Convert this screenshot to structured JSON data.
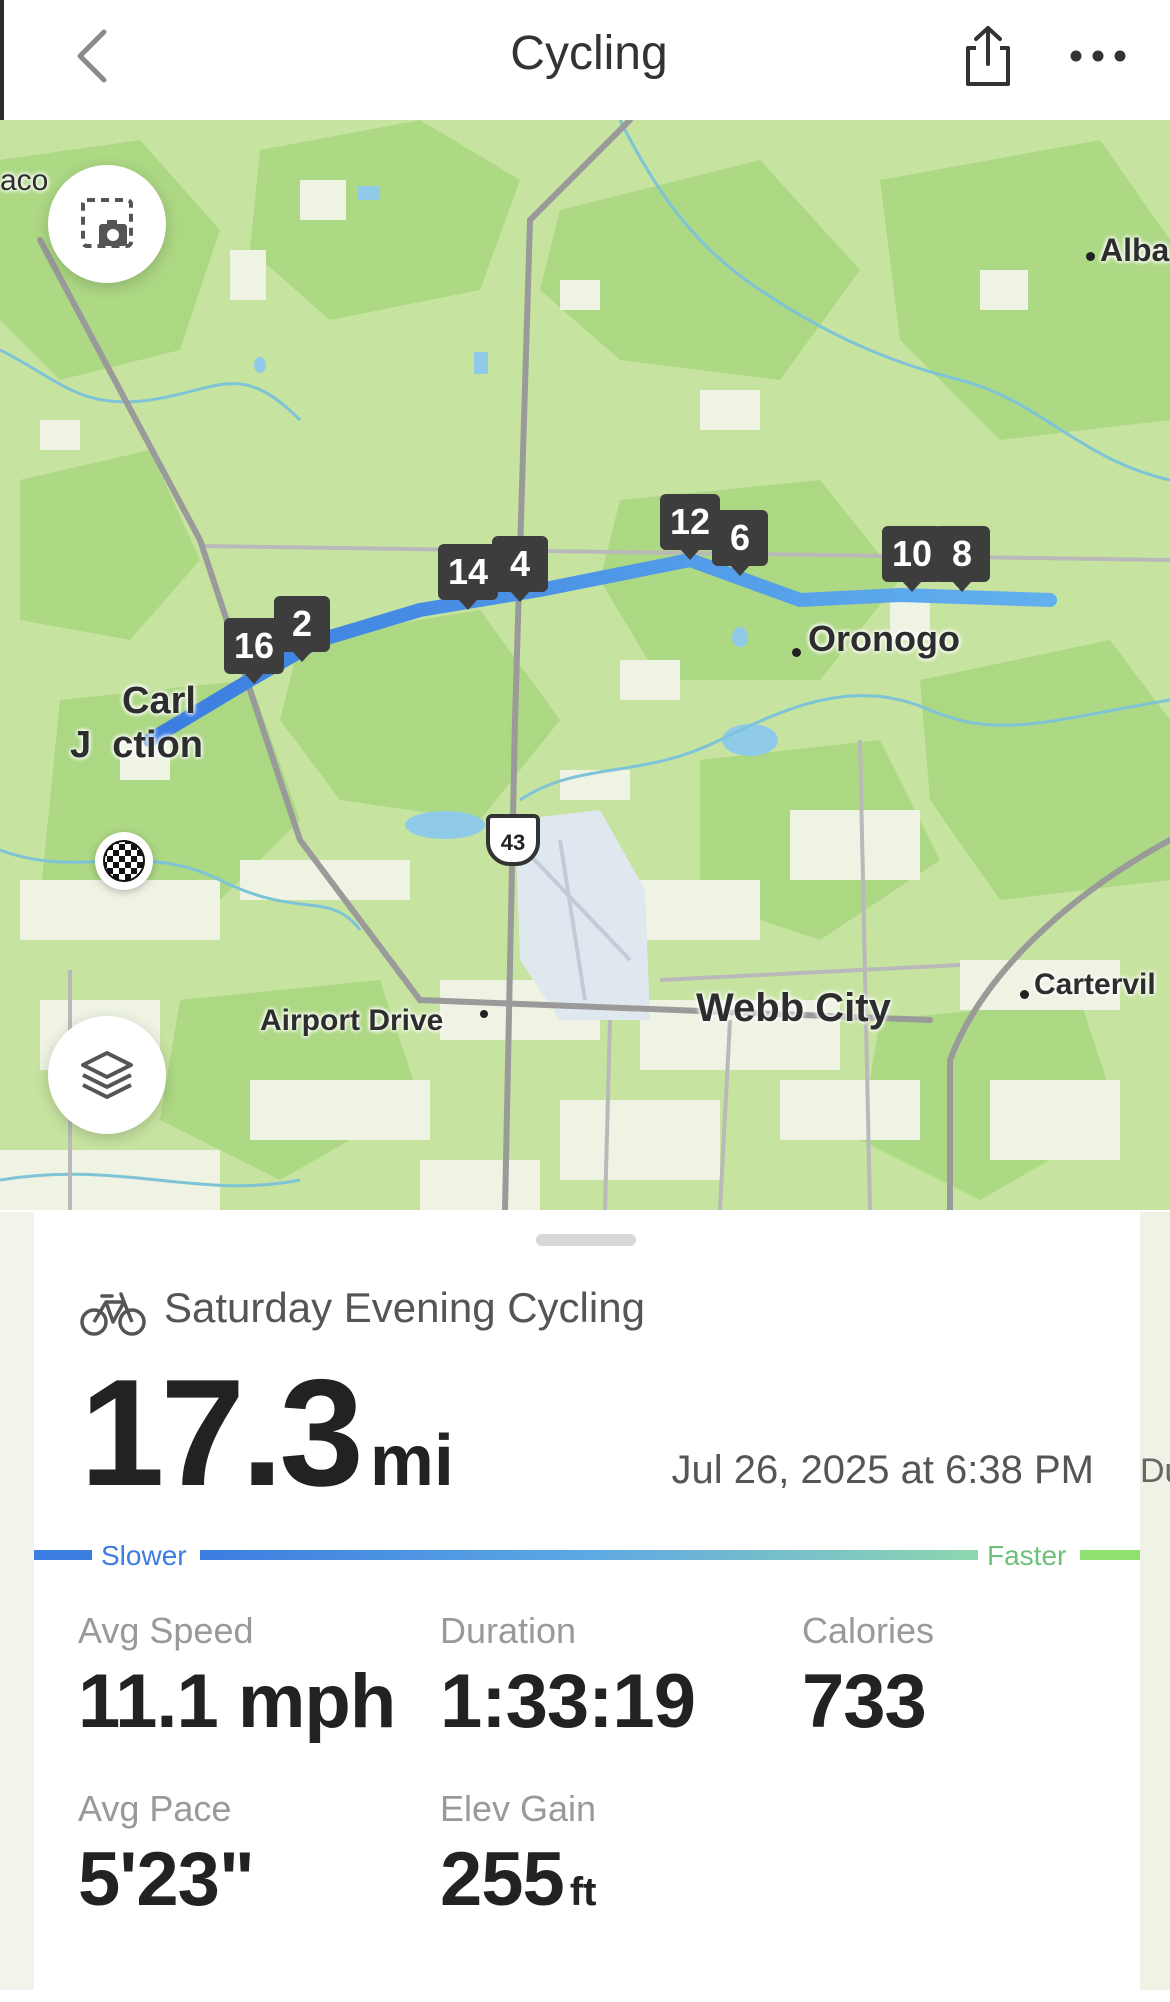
{
  "header": {
    "title": "Cycling",
    "back_icon": "chevron-left-icon",
    "share_icon": "share-icon",
    "more_icon": "more-icon"
  },
  "map": {
    "places": [
      {
        "key": "waco",
        "text": "aco"
      },
      {
        "key": "alba",
        "text": "Alba"
      },
      {
        "key": "oronogo",
        "text": "Oronogo"
      },
      {
        "key": "carl",
        "text": "Carl"
      },
      {
        "key": "junction",
        "text": "J  ction"
      },
      {
        "key": "airport",
        "text": "Airport Drive"
      },
      {
        "key": "webb",
        "text": "Webb City"
      },
      {
        "key": "carterville",
        "text": "Cartervil"
      }
    ],
    "route_shield": "43",
    "mile_markers": [
      "16",
      "2",
      "14",
      "4",
      "12",
      "6",
      "10",
      "8"
    ],
    "screenshot_icon": "camera-icon",
    "layers_icon": "layers-icon",
    "finish_icon": "checkered-flag-icon"
  },
  "activity": {
    "icon": "bicycle-icon",
    "name": "Saturday Evening Cycling",
    "distance_value": "17.3",
    "distance_unit": "mi",
    "date": "Jul 26, 2025 at 6:38 PM"
  },
  "speed_legend": {
    "slower": "Slower",
    "faster": "Faster"
  },
  "stats": {
    "avg_speed": {
      "label": "Avg Speed",
      "value": "11.1 mph"
    },
    "duration": {
      "label": "Duration",
      "value": "1:33:19"
    },
    "calories": {
      "label": "Calories",
      "value": "733"
    },
    "avg_pace": {
      "label": "Avg Pace",
      "value": "5'23\""
    },
    "elev_gain": {
      "label": "Elev Gain",
      "value": "255",
      "unit": "ft"
    }
  },
  "edge_text": "Du",
  "colors": {
    "route_start": "#3b7de0",
    "route_end": "#5aa4ea",
    "marker": "#3d3d3d",
    "faster": "#6ec07a"
  }
}
